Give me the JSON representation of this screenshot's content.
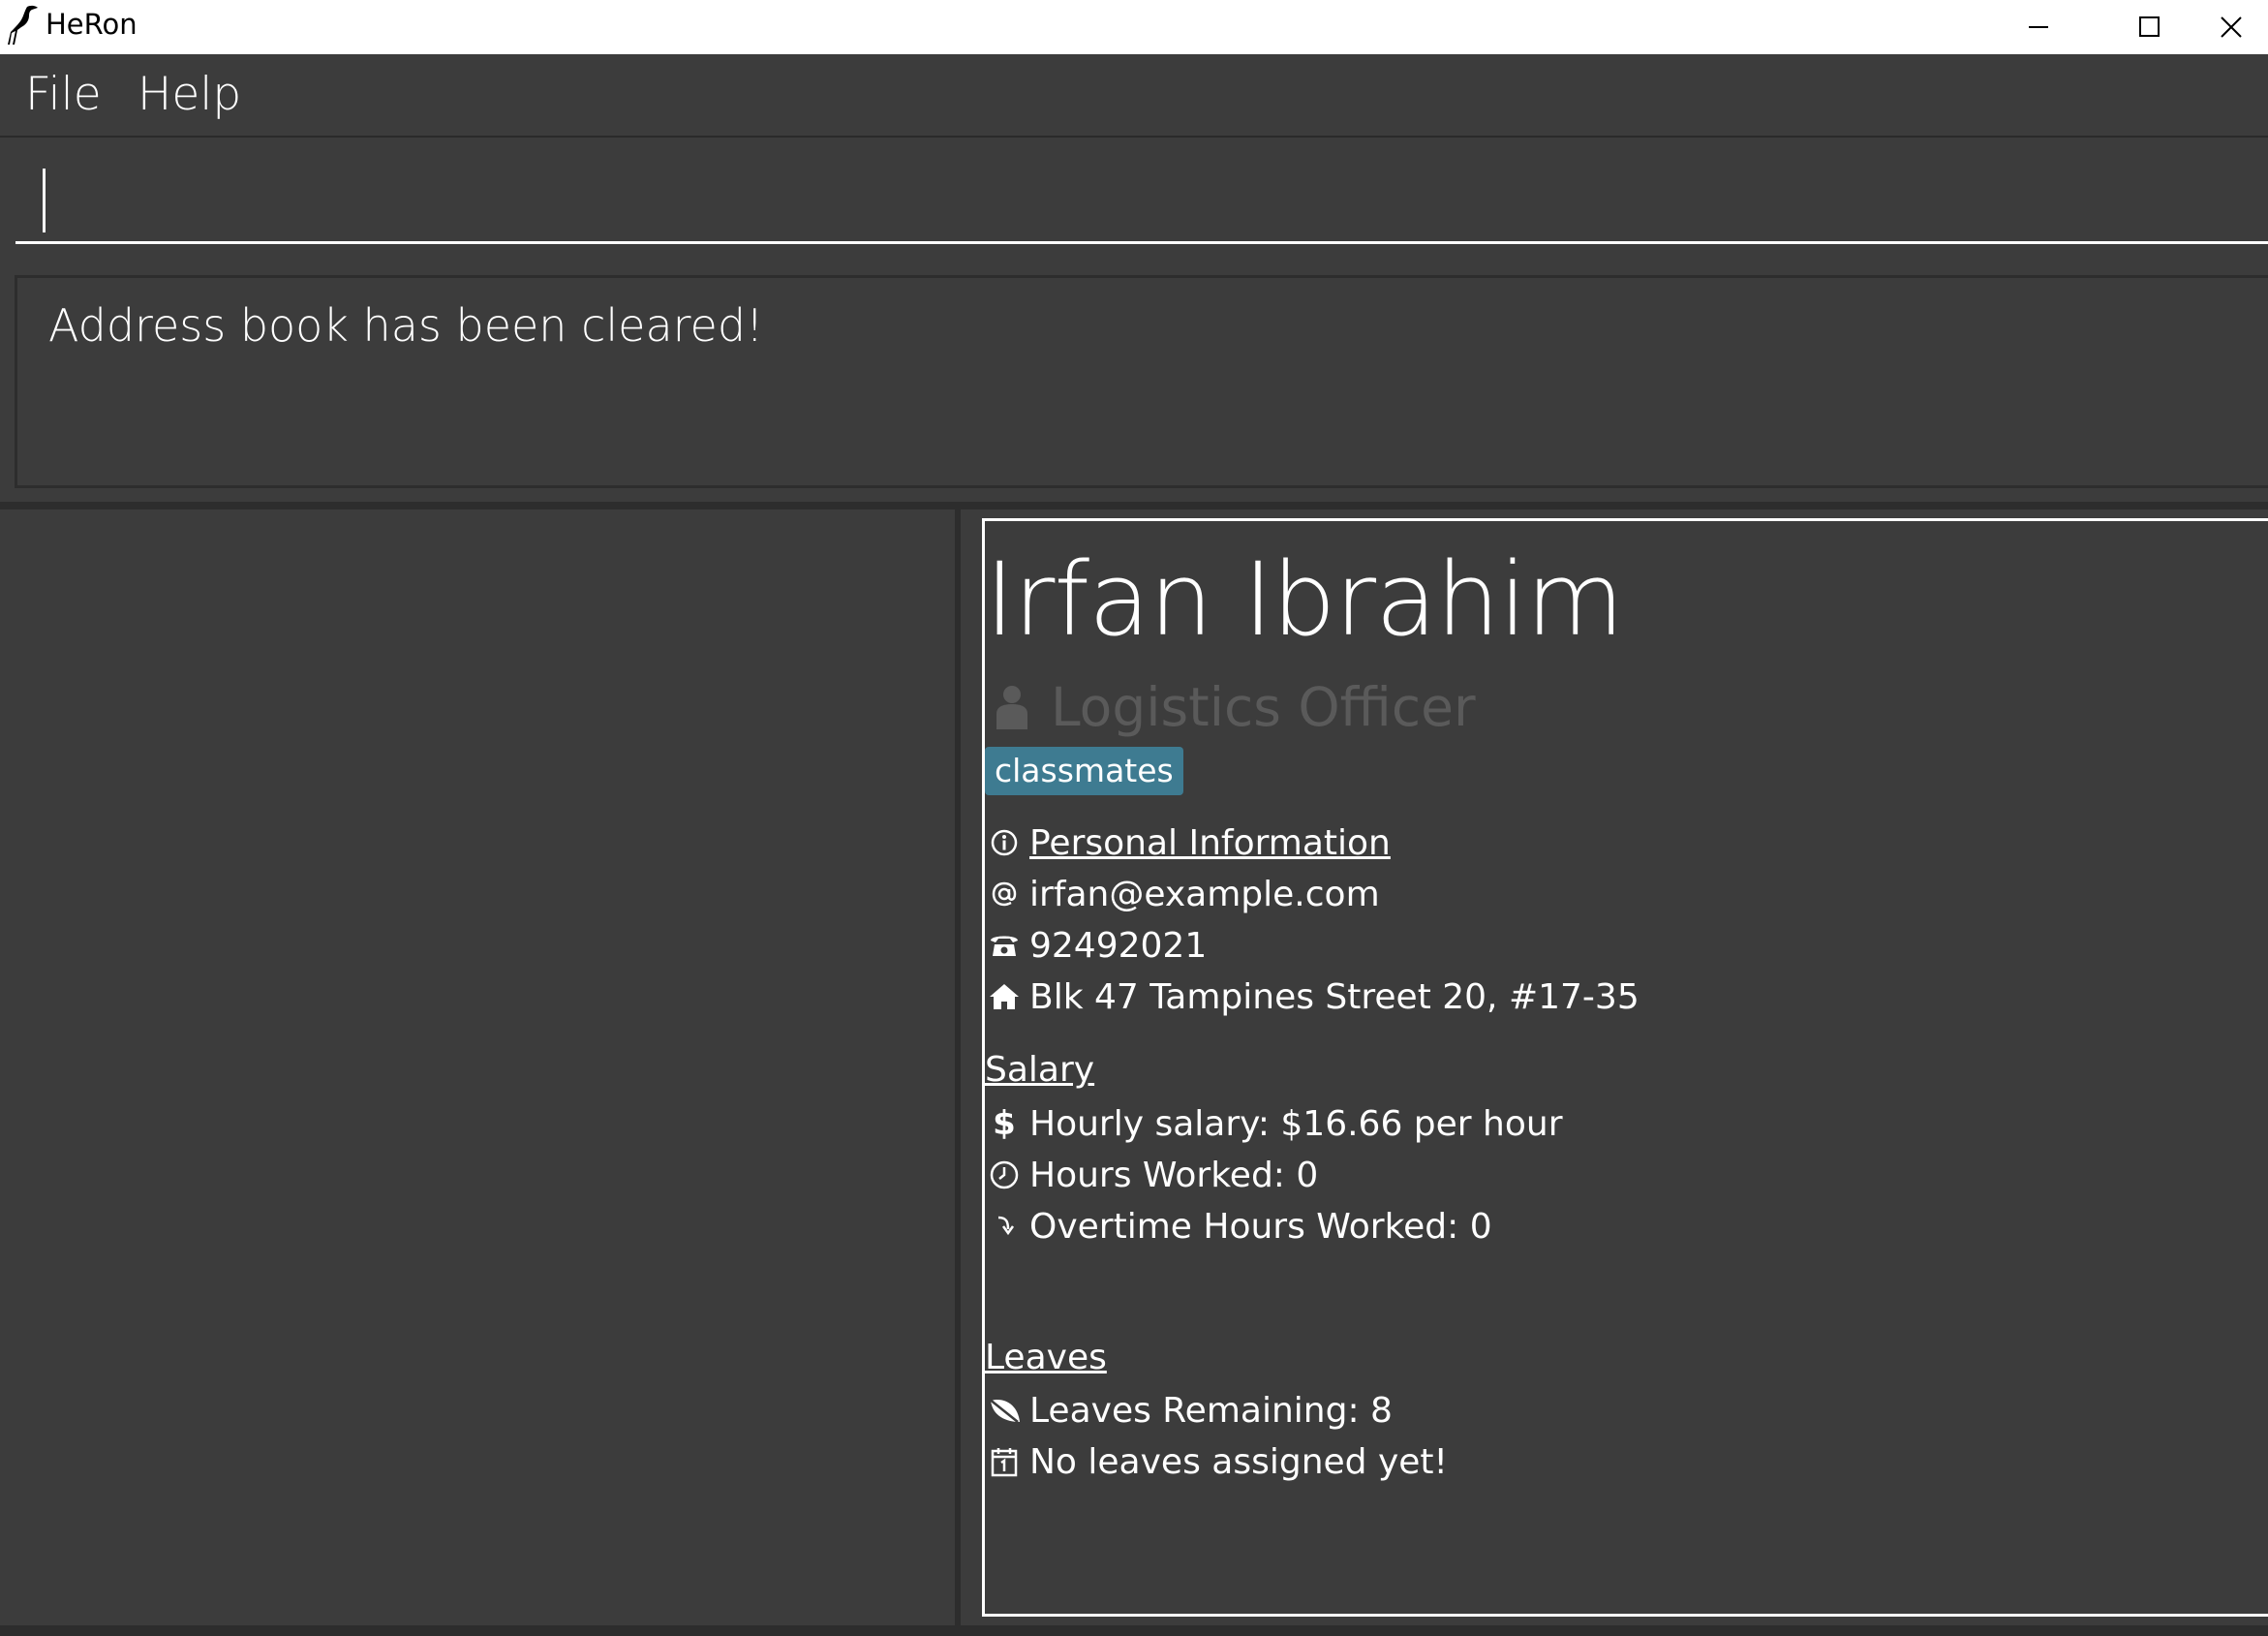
{
  "window": {
    "title": "HeRon",
    "icons": {
      "app": "heron-bird-icon",
      "minimize": "minimize-icon",
      "maximize": "maximize-icon",
      "close": "close-icon"
    }
  },
  "menu": {
    "file_label": "File",
    "help_label": "Help"
  },
  "command": {
    "value": "",
    "placeholder": ""
  },
  "result": {
    "message": "Address book has been cleared!"
  },
  "person": {
    "name": "Irfan Ibrahim",
    "role": "Logistics Officer",
    "tags": [
      "classmates"
    ],
    "personal_heading": "Personal Information",
    "email": "irfan@example.com",
    "phone": "92492021",
    "address": "Blk 47 Tampines Street 20, #17-35",
    "salary_heading": "Salary",
    "hourly_salary": "Hourly salary: $16.66 per hour",
    "hours_worked": "Hours Worked: 0",
    "overtime_hours": "Overtime Hours Worked: 0",
    "leaves_heading": "Leaves",
    "leaves_remaining": "Leaves Remaining: 8",
    "leaves_assigned": "No leaves assigned yet!"
  },
  "colors": {
    "background": "#3c3c3c",
    "tag": "#3e7b91",
    "role_text": "#5a5a5a",
    "text": "#ffffff"
  }
}
